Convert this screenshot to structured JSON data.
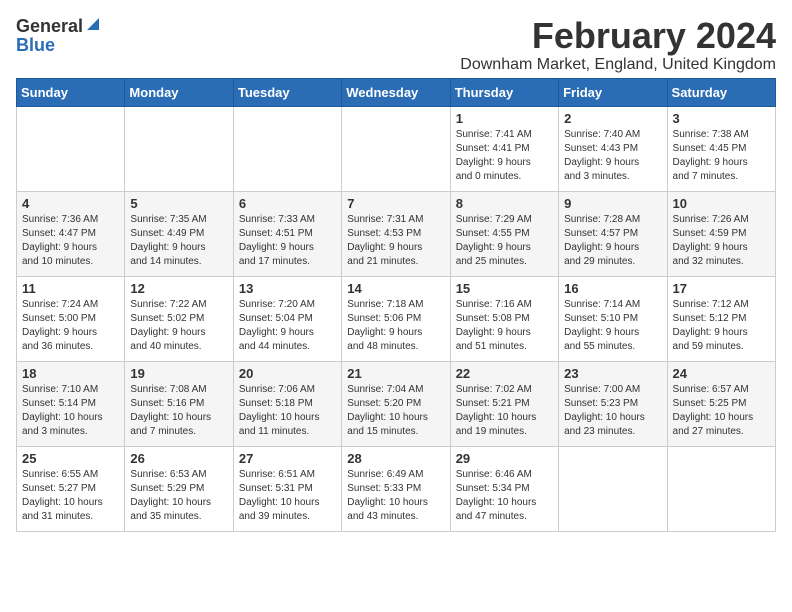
{
  "logo": {
    "general": "General",
    "blue": "Blue"
  },
  "title": "February 2024",
  "subtitle": "Downham Market, England, United Kingdom",
  "days_of_week": [
    "Sunday",
    "Monday",
    "Tuesday",
    "Wednesday",
    "Thursday",
    "Friday",
    "Saturday"
  ],
  "weeks": [
    [
      {
        "day": "",
        "info": ""
      },
      {
        "day": "",
        "info": ""
      },
      {
        "day": "",
        "info": ""
      },
      {
        "day": "",
        "info": ""
      },
      {
        "day": "1",
        "info": "Sunrise: 7:41 AM\nSunset: 4:41 PM\nDaylight: 9 hours\nand 0 minutes."
      },
      {
        "day": "2",
        "info": "Sunrise: 7:40 AM\nSunset: 4:43 PM\nDaylight: 9 hours\nand 3 minutes."
      },
      {
        "day": "3",
        "info": "Sunrise: 7:38 AM\nSunset: 4:45 PM\nDaylight: 9 hours\nand 7 minutes."
      }
    ],
    [
      {
        "day": "4",
        "info": "Sunrise: 7:36 AM\nSunset: 4:47 PM\nDaylight: 9 hours\nand 10 minutes."
      },
      {
        "day": "5",
        "info": "Sunrise: 7:35 AM\nSunset: 4:49 PM\nDaylight: 9 hours\nand 14 minutes."
      },
      {
        "day": "6",
        "info": "Sunrise: 7:33 AM\nSunset: 4:51 PM\nDaylight: 9 hours\nand 17 minutes."
      },
      {
        "day": "7",
        "info": "Sunrise: 7:31 AM\nSunset: 4:53 PM\nDaylight: 9 hours\nand 21 minutes."
      },
      {
        "day": "8",
        "info": "Sunrise: 7:29 AM\nSunset: 4:55 PM\nDaylight: 9 hours\nand 25 minutes."
      },
      {
        "day": "9",
        "info": "Sunrise: 7:28 AM\nSunset: 4:57 PM\nDaylight: 9 hours\nand 29 minutes."
      },
      {
        "day": "10",
        "info": "Sunrise: 7:26 AM\nSunset: 4:59 PM\nDaylight: 9 hours\nand 32 minutes."
      }
    ],
    [
      {
        "day": "11",
        "info": "Sunrise: 7:24 AM\nSunset: 5:00 PM\nDaylight: 9 hours\nand 36 minutes."
      },
      {
        "day": "12",
        "info": "Sunrise: 7:22 AM\nSunset: 5:02 PM\nDaylight: 9 hours\nand 40 minutes."
      },
      {
        "day": "13",
        "info": "Sunrise: 7:20 AM\nSunset: 5:04 PM\nDaylight: 9 hours\nand 44 minutes."
      },
      {
        "day": "14",
        "info": "Sunrise: 7:18 AM\nSunset: 5:06 PM\nDaylight: 9 hours\nand 48 minutes."
      },
      {
        "day": "15",
        "info": "Sunrise: 7:16 AM\nSunset: 5:08 PM\nDaylight: 9 hours\nand 51 minutes."
      },
      {
        "day": "16",
        "info": "Sunrise: 7:14 AM\nSunset: 5:10 PM\nDaylight: 9 hours\nand 55 minutes."
      },
      {
        "day": "17",
        "info": "Sunrise: 7:12 AM\nSunset: 5:12 PM\nDaylight: 9 hours\nand 59 minutes."
      }
    ],
    [
      {
        "day": "18",
        "info": "Sunrise: 7:10 AM\nSunset: 5:14 PM\nDaylight: 10 hours\nand 3 minutes."
      },
      {
        "day": "19",
        "info": "Sunrise: 7:08 AM\nSunset: 5:16 PM\nDaylight: 10 hours\nand 7 minutes."
      },
      {
        "day": "20",
        "info": "Sunrise: 7:06 AM\nSunset: 5:18 PM\nDaylight: 10 hours\nand 11 minutes."
      },
      {
        "day": "21",
        "info": "Sunrise: 7:04 AM\nSunset: 5:20 PM\nDaylight: 10 hours\nand 15 minutes."
      },
      {
        "day": "22",
        "info": "Sunrise: 7:02 AM\nSunset: 5:21 PM\nDaylight: 10 hours\nand 19 minutes."
      },
      {
        "day": "23",
        "info": "Sunrise: 7:00 AM\nSunset: 5:23 PM\nDaylight: 10 hours\nand 23 minutes."
      },
      {
        "day": "24",
        "info": "Sunrise: 6:57 AM\nSunset: 5:25 PM\nDaylight: 10 hours\nand 27 minutes."
      }
    ],
    [
      {
        "day": "25",
        "info": "Sunrise: 6:55 AM\nSunset: 5:27 PM\nDaylight: 10 hours\nand 31 minutes."
      },
      {
        "day": "26",
        "info": "Sunrise: 6:53 AM\nSunset: 5:29 PM\nDaylight: 10 hours\nand 35 minutes."
      },
      {
        "day": "27",
        "info": "Sunrise: 6:51 AM\nSunset: 5:31 PM\nDaylight: 10 hours\nand 39 minutes."
      },
      {
        "day": "28",
        "info": "Sunrise: 6:49 AM\nSunset: 5:33 PM\nDaylight: 10 hours\nand 43 minutes."
      },
      {
        "day": "29",
        "info": "Sunrise: 6:46 AM\nSunset: 5:34 PM\nDaylight: 10 hours\nand 47 minutes."
      },
      {
        "day": "",
        "info": ""
      },
      {
        "day": "",
        "info": ""
      }
    ]
  ]
}
